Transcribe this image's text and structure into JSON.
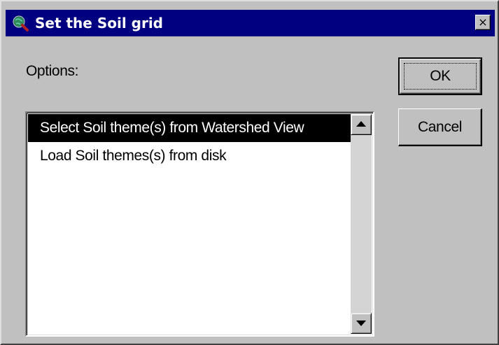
{
  "window": {
    "title": "Set the Soil grid",
    "close_label": "×"
  },
  "form": {
    "options_label": "Options:",
    "options": [
      {
        "label": "Select Soil theme(s) from Watershed View",
        "selected": true
      },
      {
        "label": "Load Soil themes(s) from disk",
        "selected": false
      }
    ]
  },
  "buttons": {
    "ok": "OK",
    "cancel": "Cancel"
  },
  "icons": {
    "app": "globe-magnifier-icon",
    "close": "close-icon",
    "scroll_up": "scroll-up-arrow-icon",
    "scroll_down": "scroll-down-arrow-icon"
  },
  "colors": {
    "titlebar": "#000080",
    "dialog_face": "#c0c0c0",
    "selection": "#000000",
    "list_background": "#ffffff"
  }
}
